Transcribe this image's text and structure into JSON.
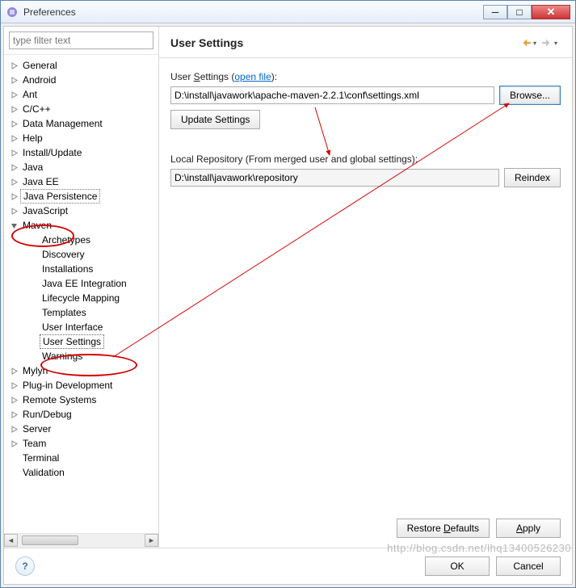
{
  "window": {
    "title": "Preferences"
  },
  "filter": {
    "placeholder": "type filter text"
  },
  "tree": {
    "items": [
      {
        "label": "General",
        "expandable": true
      },
      {
        "label": "Android",
        "expandable": true
      },
      {
        "label": "Ant",
        "expandable": true
      },
      {
        "label": "C/C++",
        "expandable": true
      },
      {
        "label": "Data Management",
        "expandable": true
      },
      {
        "label": "Help",
        "expandable": true
      },
      {
        "label": "Install/Update",
        "expandable": true
      },
      {
        "label": "Java",
        "expandable": true
      },
      {
        "label": "Java EE",
        "expandable": true
      },
      {
        "label": "Java Persistence",
        "expandable": true,
        "boxed": true
      },
      {
        "label": "JavaScript",
        "expandable": true
      },
      {
        "label": "Maven",
        "expandable": true,
        "expanded": true
      },
      {
        "label": "Mylyn",
        "expandable": true
      },
      {
        "label": "Plug-in Development",
        "expandable": true
      },
      {
        "label": "Remote Systems",
        "expandable": true
      },
      {
        "label": "Run/Debug",
        "expandable": true
      },
      {
        "label": "Server",
        "expandable": true
      },
      {
        "label": "Team",
        "expandable": true
      },
      {
        "label": "Terminal",
        "expandable": false
      },
      {
        "label": "Validation",
        "expandable": false
      }
    ],
    "mavenChildren": [
      "Archetypes",
      "Discovery",
      "Installations",
      "Java EE Integration",
      "Lifecycle Mapping",
      "Templates",
      "User Interface",
      "User Settings",
      "Warnings"
    ],
    "selectedChild": "User Settings"
  },
  "page": {
    "title": "User Settings",
    "userSettingsLabelPrefix": "User ",
    "userSettingsLabelKey": "S",
    "userSettingsLabelSuffix": "ettings (",
    "openFile": "open file",
    "userSettingsLabelEnd": "):",
    "userSettingsValue": "D:\\install\\javawork\\apache-maven-2.2.1\\conf\\settings.xml",
    "browse": "Browse...",
    "updateSettings": "Update Settings",
    "localRepoLabel": "Local Repository (From merged user and global settings):",
    "localRepoValue": "D:\\install\\javawork\\repository",
    "reindex": "Reindex",
    "restoreDefaultsPrefix": "Restore ",
    "restoreDefaultsKey": "D",
    "restoreDefaultsSuffix": "efaults",
    "applyPrefix": "",
    "applyKey": "A",
    "applySuffix": "pply"
  },
  "footer": {
    "ok": "OK",
    "cancel": "Cancel"
  },
  "watermark": "http://blog.csdn.net/lhq13400526230"
}
